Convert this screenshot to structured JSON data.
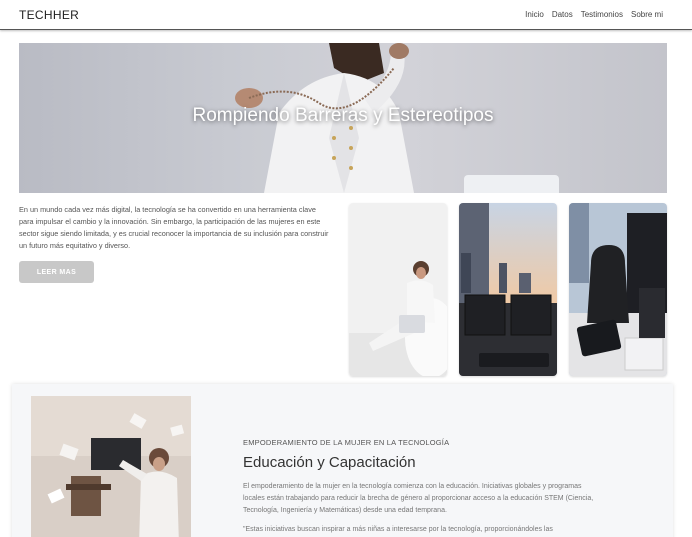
{
  "navbar": {
    "brand": "TECHHER",
    "links": [
      "Inicio",
      "Datos",
      "Testimonios",
      "Sobre mi"
    ]
  },
  "hero": {
    "title": "Rompiendo Barreras y Estereotipos"
  },
  "intro": {
    "text": "En un mundo cada vez más digital, la tecnología se ha convertido en una herramienta clave para impulsar el cambio y la innovación. Sin embargo, la participación de las mujeres en este sector sigue siendo limitada, y es crucial reconocer la importancia de su inclusión para construir un futuro más equitativo y diverso.",
    "button_label": "LEER MAS"
  },
  "section": {
    "eyebrow": "EMPODERAMIENTO DE LA MUJER EN LA TECNOLOGÍA",
    "title": "Educación y Capacitación",
    "text": "El empoderamiento de la mujer en la tecnología comienza con la educación. Iniciativas globales y programas locales están trabajando para reducir la brecha de género al proporcionar acceso a la educación STEM (Ciencia, Tecnología, Ingeniería y Matemáticas) desde una edad temprana.",
    "quote": "\"Estas iniciativas buscan inspirar a más niñas a interesarse por la tecnología, proporcionándoles las"
  },
  "colors": {
    "button": "#c8c8c8",
    "section_bg": "#f6f7f9",
    "hero_text": "#ffffff"
  }
}
